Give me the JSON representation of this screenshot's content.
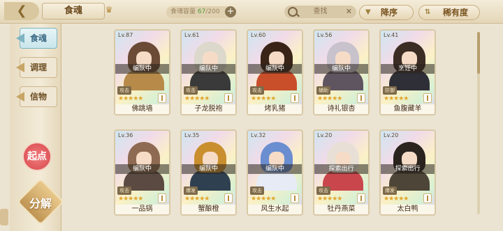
{
  "header": {
    "back_icon": "back-arrow-icon",
    "title": "食魂",
    "crown_icon": "crown-icon",
    "capacity_label": "食魂容量",
    "capacity_current": "67",
    "capacity_max": "/200",
    "capacity_add": "+",
    "search_placeholder": "查找",
    "search_close": "✕",
    "sort_label": "降序",
    "sort_icon": "▼",
    "filter_label": "稀有度",
    "filter_icon": "⇅"
  },
  "sidebar": {
    "tabs": [
      {
        "label": "食魂",
        "active": true
      },
      {
        "label": "调理",
        "active": false
      },
      {
        "label": "信物",
        "active": false
      }
    ],
    "qidian_label": "起点",
    "fenjie_label": "分解"
  },
  "cards": [
    {
      "level": "Lv.87",
      "status": "编队中",
      "role": "攻击",
      "stars": "★★★★★",
      "name": "佛跳墙",
      "hair": "#6b4a36",
      "body": "#b78a4a"
    },
    {
      "level": "Lv.61",
      "status": "编队中",
      "role": "攻击",
      "stars": "★★★★★",
      "name": "子龙脱袍",
      "hair": "#dcd8cb",
      "body": "#3a3a3a"
    },
    {
      "level": "Lv.60",
      "status": "编队中",
      "role": "攻击",
      "stars": "★★★★★",
      "name": "烤乳猪",
      "hair": "#3a2418",
      "body": "#c94f2a"
    },
    {
      "level": "Lv.56",
      "status": "编队中",
      "role": "辅助",
      "stars": "★★★★★",
      "name": "诗礼银杏",
      "hair": "#c7c2cc",
      "body": "#5f5560"
    },
    {
      "level": "Lv.41",
      "status": "烹饪中",
      "role": "防御",
      "stars": "★★★★★",
      "name": "鱼腹藏羊",
      "hair": "#3b2c24",
      "body": "#2f2f38"
    },
    {
      "level": "Lv.36",
      "status": "编队中",
      "role": "攻击",
      "stars": "★★★★★",
      "name": "一品锅",
      "hair": "#8e6a52",
      "body": "#5b4a42"
    },
    {
      "level": "Lv.35",
      "status": "编队中",
      "role": "爆发",
      "stars": "★★★★★",
      "name": "蟹酿橙",
      "hair": "#c98f2f",
      "body": "#2f4050"
    },
    {
      "level": "Lv.32",
      "status": "编队中",
      "role": "攻击",
      "stars": "★★★★★",
      "name": "风生水起",
      "hair": "#6a8ed0",
      "body": "#e6ebf6"
    },
    {
      "level": "Lv.20",
      "status": "探索出行",
      "role": "攻击",
      "stars": "★★★★★",
      "name": "牡丹燕菜",
      "hair": "#e8e0d6",
      "body": "#c9464c"
    },
    {
      "level": "Lv.20",
      "status": "探索出行",
      "role": "爆发",
      "stars": "★★★★★",
      "name": "太白鸭",
      "hair": "#2a231e",
      "body": "#4d4538"
    }
  ]
}
